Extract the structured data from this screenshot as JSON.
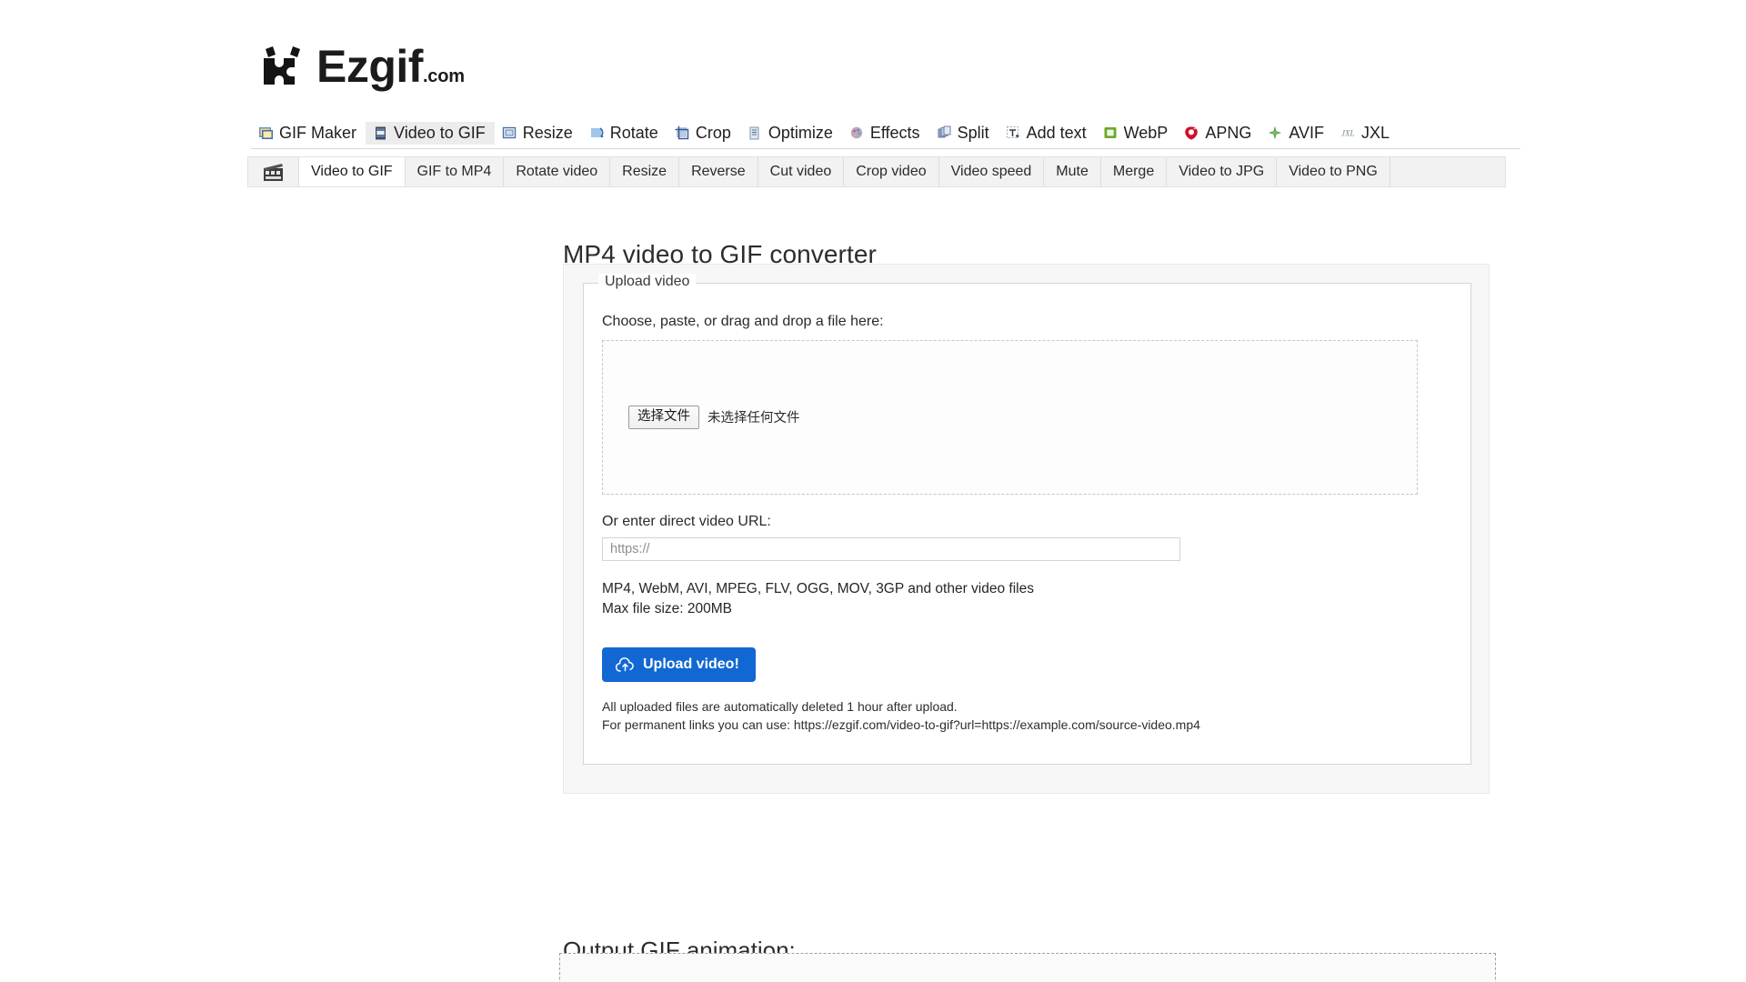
{
  "brand": {
    "name": "Ezgif",
    "tld": ".com",
    "logo_icon": "ezgif-puzzle-logo"
  },
  "main_nav": {
    "items": [
      {
        "label": "GIF Maker",
        "icon": "gif-maker-icon",
        "active": false
      },
      {
        "label": "Video to GIF",
        "icon": "video-film-icon",
        "active": true
      },
      {
        "label": "Resize",
        "icon": "resize-icon",
        "active": false
      },
      {
        "label": "Rotate",
        "icon": "rotate-icon",
        "active": false
      },
      {
        "label": "Crop",
        "icon": "crop-icon",
        "active": false
      },
      {
        "label": "Optimize",
        "icon": "optimize-icon",
        "active": false
      },
      {
        "label": "Effects",
        "icon": "effects-palette-icon",
        "active": false
      },
      {
        "label": "Split",
        "icon": "split-icon",
        "active": false
      },
      {
        "label": "Add text",
        "icon": "add-text-icon",
        "active": false
      },
      {
        "label": "WebP",
        "icon": "webp-icon",
        "active": false
      },
      {
        "label": "APNG",
        "icon": "apng-icon",
        "active": false
      },
      {
        "label": "AVIF",
        "icon": "avif-icon",
        "active": false
      },
      {
        "label": "JXL",
        "icon": "jxl-icon",
        "active": false
      }
    ]
  },
  "sub_nav": {
    "icon": "film-clapper-icon",
    "items": [
      {
        "label": "Video to GIF",
        "active": true
      },
      {
        "label": "GIF to MP4",
        "active": false
      },
      {
        "label": "Rotate video",
        "active": false
      },
      {
        "label": "Resize",
        "active": false
      },
      {
        "label": "Reverse",
        "active": false
      },
      {
        "label": "Cut video",
        "active": false
      },
      {
        "label": "Crop video",
        "active": false
      },
      {
        "label": "Video speed",
        "active": false
      },
      {
        "label": "Mute",
        "active": false
      },
      {
        "label": "Merge",
        "active": false
      },
      {
        "label": "Video to JPG",
        "active": false
      },
      {
        "label": "Video to PNG",
        "active": false
      }
    ]
  },
  "main": {
    "title": "MP4 video to GIF converter",
    "upload": {
      "legend": "Upload video",
      "choose_label": "Choose, paste, or drag and drop a file here:",
      "file_button_label": "选择文件",
      "file_status": "未选择任何文件",
      "url_label": "Or enter direct video URL:",
      "url_value": "",
      "url_placeholder": "https://",
      "formats_line": "MP4, WebM, AVI, MPEG, FLV, OGG, MOV, 3GP and other video files",
      "max_size_line": "Max file size: 200MB",
      "upload_button_label": "Upload video!",
      "upload_button_icon": "cloud-upload-icon",
      "disclaimer_line1": "All uploaded files are automatically deleted 1 hour after upload.",
      "disclaimer_line2": "For permanent links you can use: https://ezgif.com/video-to-gif?url=https://example.com/source-video.mp4"
    }
  },
  "output": {
    "title": "Output GIF animation:"
  },
  "colors": {
    "accent_blue": "#1268d3",
    "panel_bg": "#f7f7f7",
    "subnav_bg": "#f2f2f2",
    "text": "#2a2a2a"
  }
}
